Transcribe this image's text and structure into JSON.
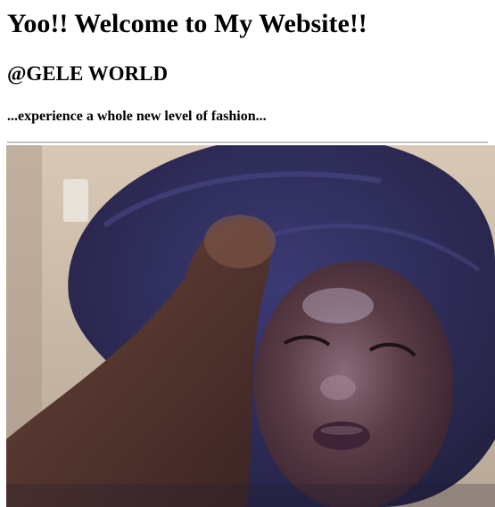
{
  "header": {
    "title": "Yoo!! Welcome to My Website!!",
    "subtitle": "@GELE WORLD",
    "tagline": "...experience a whole new level of fashion..."
  },
  "image": {
    "description": "photo of a person wearing a navy blue gele head wrap",
    "colors": {
      "wall": "#c9b8a4",
      "wrap": "#2f2d5e",
      "skin": "#5a3a3a",
      "highlight": "#b6a8c4"
    }
  }
}
